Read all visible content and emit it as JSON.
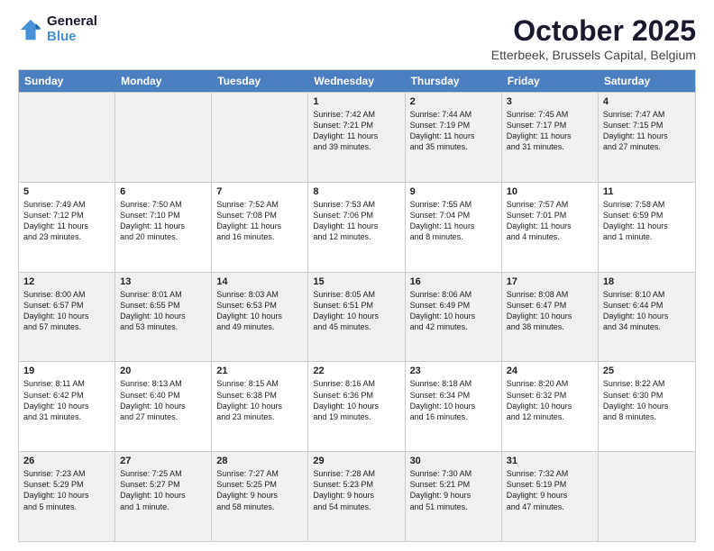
{
  "logo": {
    "line1": "General",
    "line2": "Blue"
  },
  "title": "October 2025",
  "subtitle": "Etterbeek, Brussels Capital, Belgium",
  "days": [
    "Sunday",
    "Monday",
    "Tuesday",
    "Wednesday",
    "Thursday",
    "Friday",
    "Saturday"
  ],
  "rows": [
    [
      {
        "day": "",
        "info": ""
      },
      {
        "day": "",
        "info": ""
      },
      {
        "day": "",
        "info": ""
      },
      {
        "day": "1",
        "info": "Sunrise: 7:42 AM\nSunset: 7:21 PM\nDaylight: 11 hours\nand 39 minutes."
      },
      {
        "day": "2",
        "info": "Sunrise: 7:44 AM\nSunset: 7:19 PM\nDaylight: 11 hours\nand 35 minutes."
      },
      {
        "day": "3",
        "info": "Sunrise: 7:45 AM\nSunset: 7:17 PM\nDaylight: 11 hours\nand 31 minutes."
      },
      {
        "day": "4",
        "info": "Sunrise: 7:47 AM\nSunset: 7:15 PM\nDaylight: 11 hours\nand 27 minutes."
      }
    ],
    [
      {
        "day": "5",
        "info": "Sunrise: 7:49 AM\nSunset: 7:12 PM\nDaylight: 11 hours\nand 23 minutes."
      },
      {
        "day": "6",
        "info": "Sunrise: 7:50 AM\nSunset: 7:10 PM\nDaylight: 11 hours\nand 20 minutes."
      },
      {
        "day": "7",
        "info": "Sunrise: 7:52 AM\nSunset: 7:08 PM\nDaylight: 11 hours\nand 16 minutes."
      },
      {
        "day": "8",
        "info": "Sunrise: 7:53 AM\nSunset: 7:06 PM\nDaylight: 11 hours\nand 12 minutes."
      },
      {
        "day": "9",
        "info": "Sunrise: 7:55 AM\nSunset: 7:04 PM\nDaylight: 11 hours\nand 8 minutes."
      },
      {
        "day": "10",
        "info": "Sunrise: 7:57 AM\nSunset: 7:01 PM\nDaylight: 11 hours\nand 4 minutes."
      },
      {
        "day": "11",
        "info": "Sunrise: 7:58 AM\nSunset: 6:59 PM\nDaylight: 11 hours\nand 1 minute."
      }
    ],
    [
      {
        "day": "12",
        "info": "Sunrise: 8:00 AM\nSunset: 6:57 PM\nDaylight: 10 hours\nand 57 minutes."
      },
      {
        "day": "13",
        "info": "Sunrise: 8:01 AM\nSunset: 6:55 PM\nDaylight: 10 hours\nand 53 minutes."
      },
      {
        "day": "14",
        "info": "Sunrise: 8:03 AM\nSunset: 6:53 PM\nDaylight: 10 hours\nand 49 minutes."
      },
      {
        "day": "15",
        "info": "Sunrise: 8:05 AM\nSunset: 6:51 PM\nDaylight: 10 hours\nand 45 minutes."
      },
      {
        "day": "16",
        "info": "Sunrise: 8:06 AM\nSunset: 6:49 PM\nDaylight: 10 hours\nand 42 minutes."
      },
      {
        "day": "17",
        "info": "Sunrise: 8:08 AM\nSunset: 6:47 PM\nDaylight: 10 hours\nand 38 minutes."
      },
      {
        "day": "18",
        "info": "Sunrise: 8:10 AM\nSunset: 6:44 PM\nDaylight: 10 hours\nand 34 minutes."
      }
    ],
    [
      {
        "day": "19",
        "info": "Sunrise: 8:11 AM\nSunset: 6:42 PM\nDaylight: 10 hours\nand 31 minutes."
      },
      {
        "day": "20",
        "info": "Sunrise: 8:13 AM\nSunset: 6:40 PM\nDaylight: 10 hours\nand 27 minutes."
      },
      {
        "day": "21",
        "info": "Sunrise: 8:15 AM\nSunset: 6:38 PM\nDaylight: 10 hours\nand 23 minutes."
      },
      {
        "day": "22",
        "info": "Sunrise: 8:16 AM\nSunset: 6:36 PM\nDaylight: 10 hours\nand 19 minutes."
      },
      {
        "day": "23",
        "info": "Sunrise: 8:18 AM\nSunset: 6:34 PM\nDaylight: 10 hours\nand 16 minutes."
      },
      {
        "day": "24",
        "info": "Sunrise: 8:20 AM\nSunset: 6:32 PM\nDaylight: 10 hours\nand 12 minutes."
      },
      {
        "day": "25",
        "info": "Sunrise: 8:22 AM\nSunset: 6:30 PM\nDaylight: 10 hours\nand 8 minutes."
      }
    ],
    [
      {
        "day": "26",
        "info": "Sunrise: 7:23 AM\nSunset: 5:29 PM\nDaylight: 10 hours\nand 5 minutes."
      },
      {
        "day": "27",
        "info": "Sunrise: 7:25 AM\nSunset: 5:27 PM\nDaylight: 10 hours\nand 1 minute."
      },
      {
        "day": "28",
        "info": "Sunrise: 7:27 AM\nSunset: 5:25 PM\nDaylight: 9 hours\nand 58 minutes."
      },
      {
        "day": "29",
        "info": "Sunrise: 7:28 AM\nSunset: 5:23 PM\nDaylight: 9 hours\nand 54 minutes."
      },
      {
        "day": "30",
        "info": "Sunrise: 7:30 AM\nSunset: 5:21 PM\nDaylight: 9 hours\nand 51 minutes."
      },
      {
        "day": "31",
        "info": "Sunrise: 7:32 AM\nSunset: 5:19 PM\nDaylight: 9 hours\nand 47 minutes."
      },
      {
        "day": "",
        "info": ""
      }
    ]
  ]
}
